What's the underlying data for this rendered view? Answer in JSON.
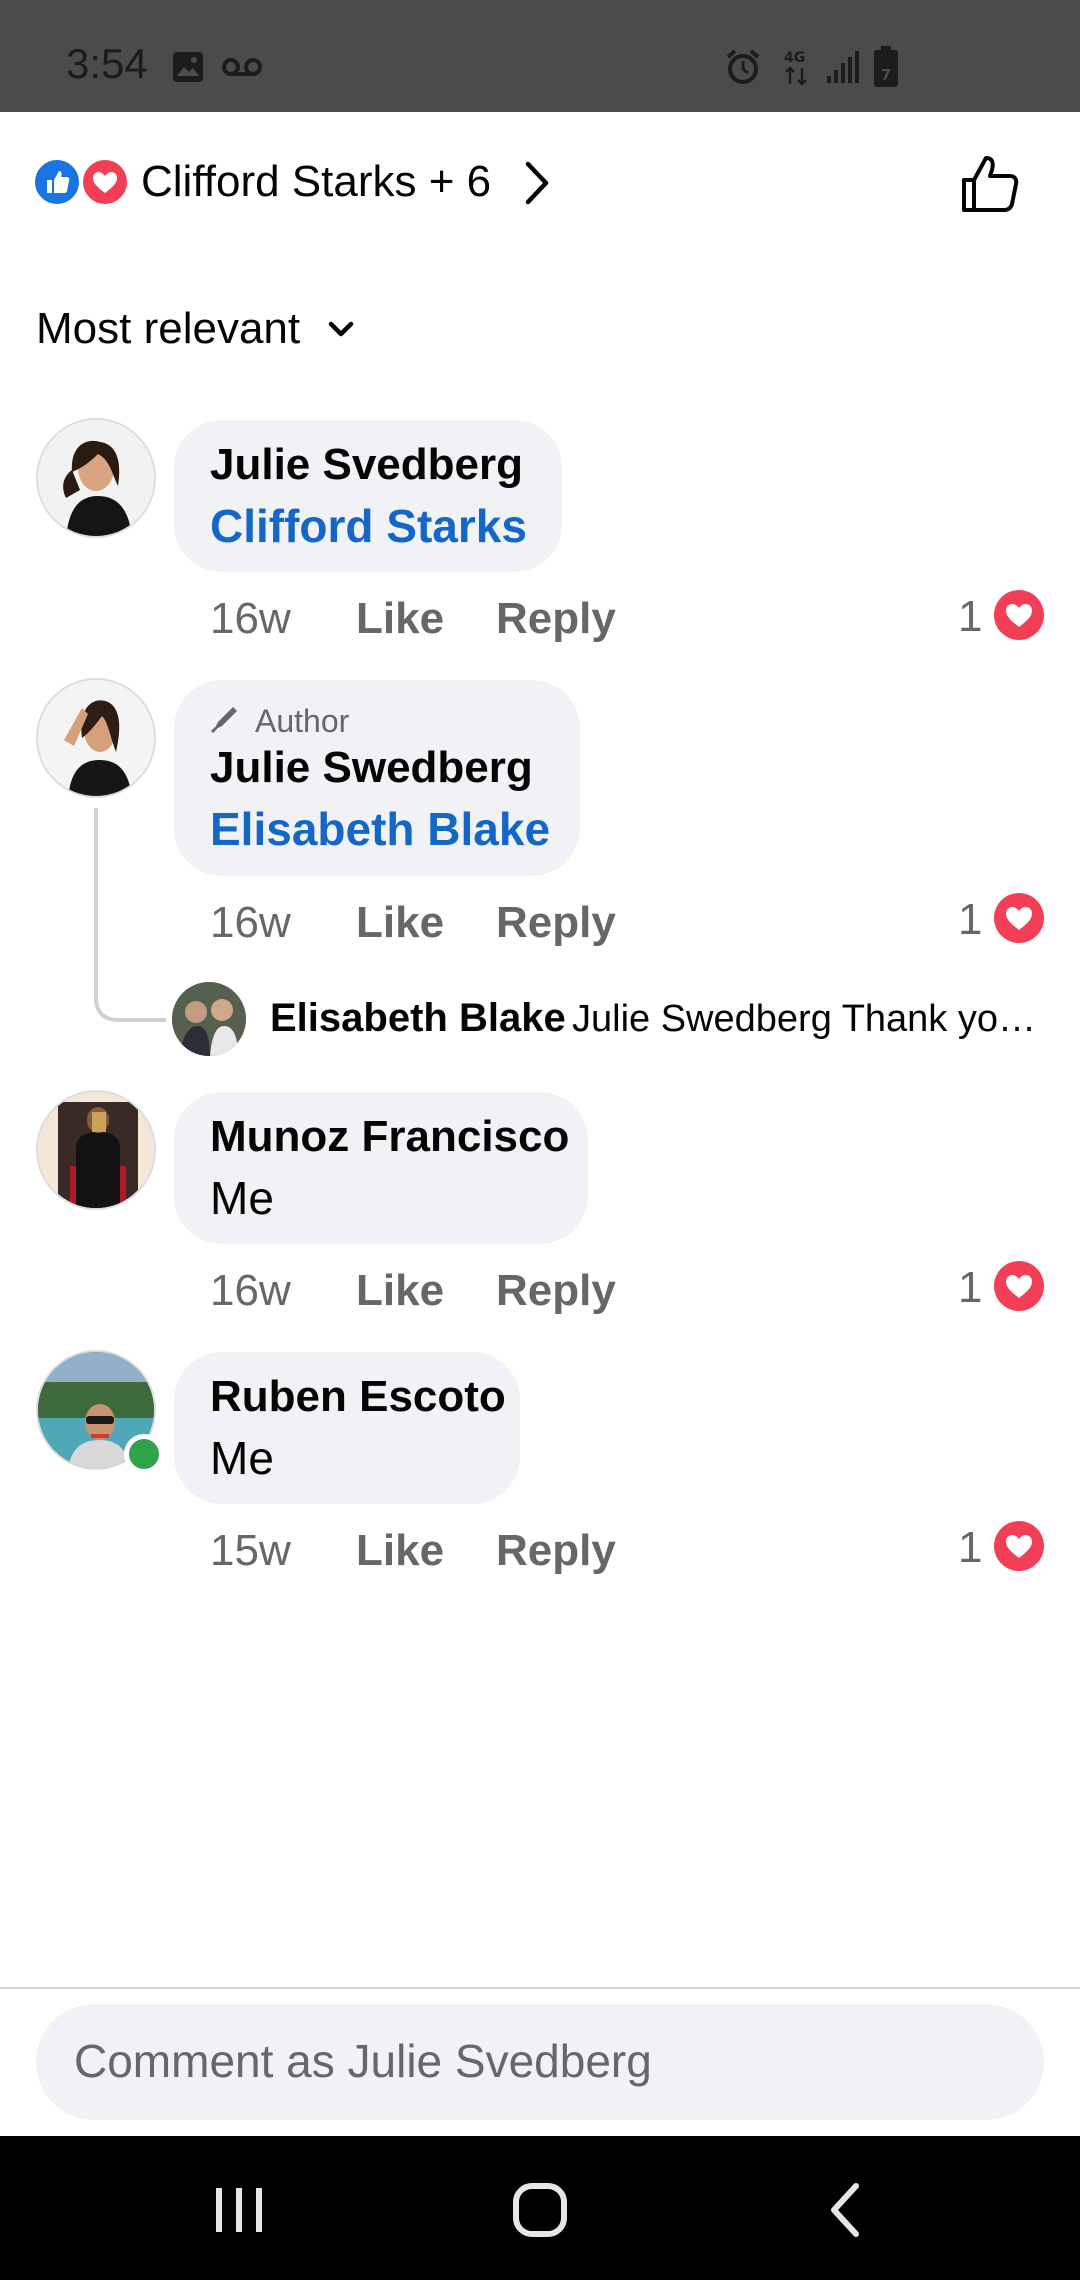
{
  "status_bar": {
    "time": "3:54",
    "battery_level": "7"
  },
  "reactions": {
    "summary": "Clifford Starks + 6",
    "types": [
      "like",
      "love"
    ]
  },
  "sort": {
    "label": "Most relevant"
  },
  "comments": [
    {
      "name": "Julie Svedberg",
      "text": "Clifford Starks",
      "time": "16w",
      "like": "Like",
      "reply": "Reply",
      "reaction_count": "1"
    },
    {
      "badge": "Author",
      "name": "Julie Swedberg",
      "text": "Elisabeth Blake",
      "time": "16w",
      "like": "Like",
      "reply": "Reply",
      "reaction_count": "1",
      "reply_preview": {
        "name": "Elisabeth Blake",
        "text": "Julie Swedberg Thank yo…"
      }
    },
    {
      "name": "Munoz Francisco",
      "text": "Me",
      "time": "16w",
      "like": "Like",
      "reply": "Reply",
      "reaction_count": "1"
    },
    {
      "name": "Ruben Escoto",
      "text": "Me",
      "time": "15w",
      "like": "Like",
      "reply": "Reply",
      "reaction_count": "1"
    }
  ],
  "composer": {
    "placeholder": "Comment as Julie Svedberg"
  },
  "colors": {
    "accent": "#1467c6",
    "like_blue": "#1b74e4",
    "love_red": "#f33e58",
    "online_green": "#31a24c"
  }
}
